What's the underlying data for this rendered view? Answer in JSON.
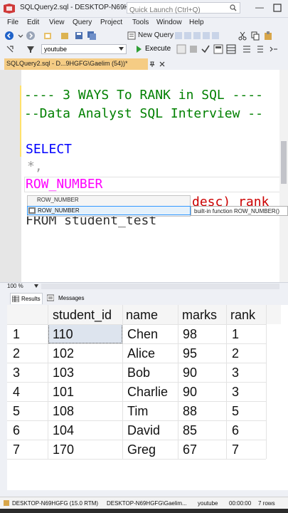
{
  "window": {
    "title": "SQLQuery2.sql - DESKTOP-N69H...",
    "quick_launch_placeholder": "Quick Launch (Ctrl+Q)"
  },
  "menu": [
    "File",
    "Edit",
    "View",
    "Query",
    "Project",
    "Tools",
    "Window",
    "Help"
  ],
  "toolbar": {
    "new_query": "New Query",
    "database": "youtube",
    "execute": "Execute"
  },
  "tab": {
    "label": "SQLQuery2.sql - D...9HGFG\\Gaelim (54))*"
  },
  "editor": {
    "line1": "---- 3 WAYS To RANK in SQL ----",
    "line2": "--Data Analyst SQL Interview --",
    "line3": "SELECT",
    "line4": "*,",
    "line5": "ROW_NUMBER",
    "line6_tail": "desc) rank",
    "line7": "FROM student_test"
  },
  "autocomplete": {
    "items": [
      "ROW_NUMBER",
      "ROW_NUMBER"
    ],
    "tooltip": "built-in function ROW_NUMBER()"
  },
  "zoom": "100 %",
  "results_tabs": {
    "results": "Results",
    "messages": "Messages"
  },
  "grid": {
    "columns": [
      "student_id",
      "name",
      "marks",
      "rank"
    ],
    "rows": [
      {
        "n": "1",
        "student_id": "110",
        "name": "Chen",
        "marks": "98",
        "rank": "1"
      },
      {
        "n": "2",
        "student_id": "102",
        "name": "Alice",
        "marks": "95",
        "rank": "2"
      },
      {
        "n": "3",
        "student_id": "103",
        "name": "Bob",
        "marks": "90",
        "rank": "3"
      },
      {
        "n": "4",
        "student_id": "101",
        "name": "Charlie",
        "marks": "90",
        "rank": "3"
      },
      {
        "n": "5",
        "student_id": "108",
        "name": "Tim",
        "marks": "88",
        "rank": "5"
      },
      {
        "n": "6",
        "student_id": "104",
        "name": "David",
        "marks": "85",
        "rank": "6"
      },
      {
        "n": "7",
        "student_id": "170",
        "name": "Greg",
        "marks": "67",
        "rank": "7"
      }
    ]
  },
  "status": {
    "server": "DESKTOP-N69HGFG (15.0 RTM)",
    "user": "DESKTOP-N69HGFG\\Gaelim...",
    "database": "youtube",
    "elapsed": "00:00:00",
    "rows": "7 rows"
  },
  "colors": {
    "comment": "#008000",
    "keyword": "#0000ff",
    "function": "#ff00ff",
    "tab_active": "#f5cc84"
  }
}
